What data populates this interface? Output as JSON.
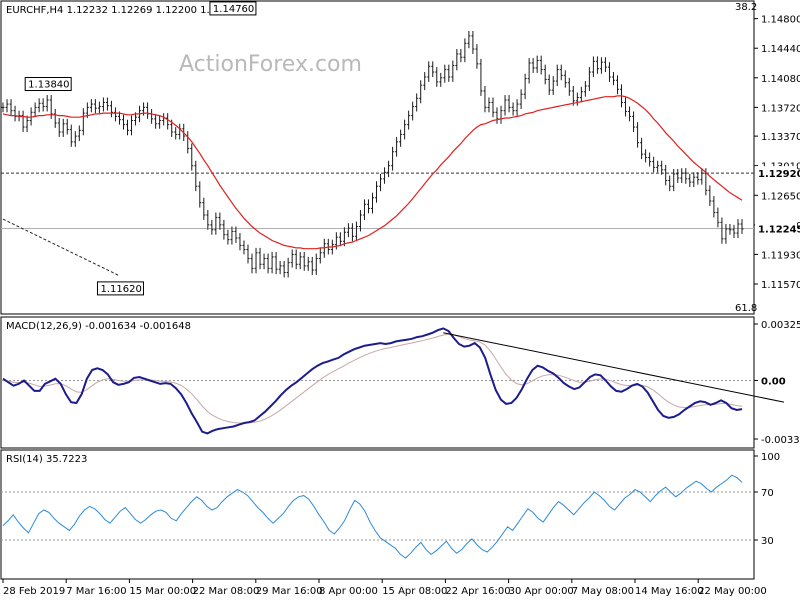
{
  "chart_data": [
    {
      "type": "line",
      "panel": "price",
      "title": "EURCHF,H4  1.12232 1.12269 1.12200 1.12245",
      "watermark": "ActionForex.com",
      "ylim": [
        1.1157,
        1.1482
      ],
      "y_ticks": [
        "1.14800",
        "1.14440",
        "1.14080",
        "1.13720",
        "1.13370",
        "1.13010",
        "1.12650",
        "1.12290",
        "1.11930",
        "1.11570"
      ],
      "x_labels": [
        "28 Feb 2019",
        "7 Mar 16:00",
        "15 Mar 00:00",
        "22 Mar 08:00",
        "29 Mar 16:00",
        "8 Apr 00:00",
        "15 Apr 08:00",
        "22 Apr 16:00",
        "30 Apr 00:00",
        "7 May 08:00",
        "14 May 16:00",
        "22 May 00:00"
      ],
      "fib_top_label": "38.2",
      "fib_bottom_label": "61.8",
      "annotations": [
        {
          "label": "1.13840",
          "x_index": 11,
          "y": 1.1384
        },
        {
          "label": "1.14760",
          "x_index": 57,
          "y": 1.1476
        },
        {
          "label": "1.11620",
          "x_index": 29,
          "y": 1.1162
        }
      ],
      "horizontal_level": {
        "label": "1.12920",
        "y": 1.1292
      },
      "current_price": {
        "label": "1.12245",
        "y": 1.12245
      },
      "trendline": {
        "from": {
          "x_index": 0,
          "y": 1.1236
        },
        "to": {
          "x_index": 29,
          "y": 1.1167
        }
      },
      "series": [
        {
          "kind": "price",
          "values": [
            1.1372,
            1.1376,
            1.1368,
            1.1361,
            1.1362,
            1.1348,
            1.1356,
            1.1366,
            1.1372,
            1.1377,
            1.1373,
            1.1381,
            1.1364,
            1.1353,
            1.1342,
            1.1352,
            1.1345,
            1.133,
            1.1337,
            1.1344,
            1.1365,
            1.1372,
            1.1376,
            1.1371,
            1.1373,
            1.1378,
            1.1374,
            1.1366,
            1.1361,
            1.1357,
            1.1351,
            1.1344,
            1.1356,
            1.136,
            1.1368,
            1.1372,
            1.1364,
            1.1358,
            1.1352,
            1.1356,
            1.1359,
            1.1351,
            1.1342,
            1.1339,
            1.1346,
            1.1337,
            1.1322,
            1.1301,
            1.1276,
            1.1256,
            1.1241,
            1.1229,
            1.1223,
            1.1238,
            1.1229,
            1.1217,
            1.1211,
            1.1221,
            1.1213,
            1.1204,
            1.1199,
            1.1188,
            1.1176,
            1.1195,
            1.1181,
            1.1188,
            1.1176,
            1.119,
            1.1175,
            1.1179,
            1.1171,
            1.1183,
            1.1193,
            1.1181,
            1.119,
            1.1179,
            1.1184,
            1.1174,
            1.1188,
            1.1195,
            1.1206,
            1.1199,
            1.1205,
            1.1214,
            1.1209,
            1.122,
            1.1225,
            1.1215,
            1.1227,
            1.1241,
            1.1254,
            1.1249,
            1.1262,
            1.1276,
            1.1285,
            1.1293,
            1.1301,
            1.1318,
            1.133,
            1.1339,
            1.1351,
            1.1362,
            1.1373,
            1.1383,
            1.1399,
            1.1409,
            1.1422,
            1.1415,
            1.1403,
            1.1408,
            1.1418,
            1.1409,
            1.1423,
            1.1437,
            1.1433,
            1.145,
            1.1459,
            1.1443,
            1.1425,
            1.1392,
            1.1372,
            1.1378,
            1.1366,
            1.1358,
            1.1368,
            1.1381,
            1.1372,
            1.1368,
            1.1376,
            1.1388,
            1.1407,
            1.1426,
            1.142,
            1.1429,
            1.1418,
            1.1406,
            1.1393,
            1.1404,
            1.1418,
            1.1411,
            1.1402,
            1.1392,
            1.138,
            1.1384,
            1.1391,
            1.1398,
            1.1415,
            1.1428,
            1.1419,
            1.1427,
            1.1421,
            1.1409,
            1.1405,
            1.1394,
            1.1378,
            1.1367,
            1.1361,
            1.1348,
            1.1329,
            1.1315,
            1.1311,
            1.1306,
            1.1299,
            1.1301,
            1.1296,
            1.1283,
            1.1276,
            1.1291,
            1.1286,
            1.1292,
            1.1285,
            1.1281,
            1.1287,
            1.1284,
            1.1292,
            1.1271,
            1.1258,
            1.1244,
            1.1232,
            1.1212,
            1.1224,
            1.1223,
            1.1219,
            1.123,
            1.1224
          ]
        },
        {
          "kind": "moving_average",
          "values": [
            1.1364,
            1.1363,
            1.1362,
            1.1362,
            1.1361,
            1.1361,
            1.136,
            1.136,
            1.1361,
            1.1362,
            1.1362,
            1.1363,
            1.1363,
            1.1363,
            1.1362,
            1.1362,
            1.1361,
            1.136,
            1.136,
            1.136,
            1.1361,
            1.1362,
            1.1363,
            1.1364,
            1.1364,
            1.1365,
            1.1365,
            1.1365,
            1.1365,
            1.1365,
            1.1364,
            1.1363,
            1.1363,
            1.1364,
            1.1364,
            1.1365,
            1.1365,
            1.1364,
            1.1363,
            1.1362,
            1.136,
            1.1357,
            1.1354,
            1.135,
            1.1346,
            1.1341,
            1.1336,
            1.133,
            1.1323,
            1.1316,
            1.1308,
            1.1301,
            1.1293,
            1.1285,
            1.1277,
            1.127,
            1.1263,
            1.1256,
            1.1249,
            1.1243,
            1.1237,
            1.1232,
            1.1227,
            1.1223,
            1.1219,
            1.1216,
            1.1213,
            1.121,
            1.1208,
            1.1206,
            1.1204,
            1.1203,
            1.1202,
            1.1201,
            1.1201,
            1.12,
            1.12,
            1.12,
            1.12,
            1.1201,
            1.1201,
            1.1202,
            1.1202,
            1.1203,
            1.1204,
            1.1206,
            1.1207,
            1.1208,
            1.121,
            1.1212,
            1.1214,
            1.1216,
            1.1219,
            1.1222,
            1.1225,
            1.1228,
            1.1232,
            1.1236,
            1.124,
            1.1245,
            1.125,
            1.1255,
            1.1261,
            1.1267,
            1.1273,
            1.1279,
            1.1285,
            1.1291,
            1.1296,
            1.1302,
            1.1307,
            1.1312,
            1.1318,
            1.1323,
            1.1328,
            1.1334,
            1.1339,
            1.1344,
            1.1348,
            1.1351,
            1.1352,
            1.1354,
            1.1356,
            1.1357,
            1.1358,
            1.1359,
            1.1359,
            1.136,
            1.1361,
            1.1362,
            1.1364,
            1.1365,
            1.1366,
            1.1368,
            1.1369,
            1.137,
            1.1371,
            1.1372,
            1.1373,
            1.1374,
            1.1375,
            1.1376,
            1.1377,
            1.1378,
            1.1379,
            1.138,
            1.1381,
            1.1382,
            1.1383,
            1.1384,
            1.1385,
            1.1385,
            1.1385,
            1.1386,
            1.1386,
            1.1385,
            1.1383,
            1.138,
            1.1377,
            1.1373,
            1.1369,
            1.1364,
            1.1358,
            1.1353,
            1.1347,
            1.1341,
            1.1336,
            1.1331,
            1.1325,
            1.132,
            1.1315,
            1.131,
            1.1305,
            1.1301,
            1.1297,
            1.1293,
            1.1288,
            1.1284,
            1.128,
            1.1276,
            1.1272,
            1.1268,
            1.1265,
            1.1262,
            1.1259
          ]
        }
      ]
    },
    {
      "type": "line",
      "panel": "macd",
      "title": "MACD(12,26,9) -0.001634 -0.001648",
      "ylim": [
        -0.003373,
        0.003253
      ],
      "y_ticks": [
        "0.003253",
        "0.00",
        "-0.003373"
      ],
      "zero_level": 0.0,
      "trendline": {
        "from": {
          "x_index": 84,
          "y": 0.00275
        },
        "to": {
          "x_index": 149,
          "y": -0.00125
        }
      },
      "series": [
        {
          "kind": "macd",
          "values": [
            0.0001,
            -0.0001,
            -0.0003,
            -0.0002,
            0.0,
            -0.0003,
            -0.0006,
            -0.0006,
            -0.0002,
            -5e-05,
            0.0001,
            -0.0002,
            -0.0008,
            -0.00125,
            -0.0013,
            -0.0008,
            0.0001,
            0.0006,
            0.0007,
            0.0006,
            0.00035,
            -0.0001,
            -0.00025,
            -0.0002,
            -0.0001,
            0.00015,
            0.0002,
            0.0001,
            0.0,
            -0.0001,
            -0.0002,
            -0.00015,
            -0.0002,
            -0.00045,
            -0.0008,
            -0.0013,
            -0.0019,
            -0.0024,
            -0.00295,
            -0.00305,
            -0.0029,
            -0.0028,
            -0.00275,
            -0.0027,
            -0.00265,
            -0.00255,
            -0.00245,
            -0.0024,
            -0.0023,
            -0.00205,
            -0.0018,
            -0.0015,
            -0.0012,
            -0.00085,
            -0.00055,
            -0.0003,
            -0.0001,
            0.00015,
            0.0004,
            0.00065,
            0.00085,
            0.001,
            0.0011,
            0.0012,
            0.0013,
            0.0015,
            0.00165,
            0.0018,
            0.0019,
            0.002,
            0.00205,
            0.0021,
            0.00215,
            0.0021,
            0.00215,
            0.00225,
            0.0023,
            0.00235,
            0.0024,
            0.0025,
            0.00255,
            0.00265,
            0.00275,
            0.0029,
            0.003,
            0.00285,
            0.00245,
            0.0021,
            0.00195,
            0.002,
            0.00215,
            0.0019,
            0.0013,
            0.00035,
            -0.00055,
            -0.0011,
            -0.00135,
            -0.0013,
            -0.001,
            -0.0005,
            0.0001,
            0.0006,
            0.00085,
            0.00075,
            0.00055,
            0.0004,
            0.00015,
            -0.00015,
            -0.00035,
            -0.0005,
            -0.0004,
            -0.0001,
            0.0002,
            0.00035,
            0.0003,
            0.0,
            -0.00035,
            -0.0006,
            -0.00065,
            -0.0005,
            -0.0003,
            -0.0002,
            -0.00035,
            -0.0007,
            -0.0012,
            -0.0017,
            -0.00205,
            -0.00215,
            -0.0021,
            -0.00195,
            -0.0017,
            -0.0015,
            -0.0013,
            -0.0012,
            -0.00125,
            -0.0014,
            -0.0013,
            -0.00115,
            -0.0013,
            -0.0016,
            -0.0017,
            -0.00165
          ]
        },
        {
          "kind": "signal",
          "values": [
            0.0,
            -5e-05,
            -0.0001,
            -0.00013,
            -0.0001,
            -0.00015,
            -0.00025,
            -0.00035,
            -0.00032,
            -0.00027,
            -0.00019,
            -0.00019,
            -0.00031,
            -0.0005,
            -0.00066,
            -0.00069,
            -0.00053,
            -0.0003,
            -0.0001,
            4e-05,
            0.0001,
            6e-05,
            0.0,
            -4e-05,
            -5e-05,
            -1e-05,
            3e-05,
            4e-05,
            3e-05,
            0.0,
            -4e-05,
            -6e-05,
            -9e-05,
            -0.00016,
            -0.00029,
            -0.00049,
            -0.00077,
            -0.0011,
            -0.00147,
            -0.00179,
            -0.00201,
            -0.00217,
            -0.00229,
            -0.00237,
            -0.00243,
            -0.00245,
            -0.00245,
            -0.00244,
            -0.00241,
            -0.00234,
            -0.00223,
            -0.00208,
            -0.0019,
            -0.00169,
            -0.00146,
            -0.00123,
            -0.001,
            -0.00077,
            -0.00053,
            -0.0003,
            -7e-05,
            0.00015,
            0.00034,
            0.00051,
            0.00067,
            0.00083,
            0.001,
            0.00116,
            0.00131,
            0.00145,
            0.00157,
            0.00168,
            0.00177,
            0.00184,
            0.0019,
            0.00197,
            0.00204,
            0.0021,
            0.00216,
            0.00223,
            0.00229,
            0.00237,
            0.00244,
            0.00253,
            0.00262,
            0.00267,
            0.00263,
            0.00252,
            0.00241,
            0.00233,
            0.00229,
            0.00221,
            0.00203,
            0.00169,
            0.00124,
            0.00077,
            0.00035,
            2e-05,
            -0.00018,
            -0.00025,
            -0.00018,
            -2e-05,
            0.00015,
            0.00027,
            0.00033,
            0.00034,
            0.0003,
            0.00021,
            0.0001,
            -2e-05,
            -0.0001,
            -0.0001,
            -4e-05,
            4e-05,
            9e-05,
            7e-05,
            -2e-05,
            -0.00014,
            -0.00024,
            -0.00029,
            -0.00029,
            -0.00027,
            -0.00029,
            -0.00037,
            -0.00054,
            -0.00077,
            -0.00103,
            -0.00125,
            -0.00142,
            -0.00153,
            -0.00156,
            -0.00155,
            -0.0015,
            -0.00144,
            -0.0014,
            -0.0014,
            -0.00138,
            -0.00133,
            -0.00133,
            -0.00138,
            -0.00145,
            -0.00149
          ]
        }
      ]
    },
    {
      "type": "line",
      "panel": "rsi",
      "title": "RSI(14) 35.7223",
      "ylim": [
        0,
        100
      ],
      "y_ticks": [
        "100",
        "70",
        "30"
      ],
      "levels": [
        70,
        30
      ],
      "series": [
        {
          "kind": "rsi",
          "values": [
            42,
            46,
            51,
            45,
            40,
            36,
            44,
            52,
            55,
            53,
            48,
            44,
            41,
            38,
            43,
            50,
            55,
            58,
            56,
            52,
            47,
            44,
            49,
            54,
            57,
            52,
            47,
            44,
            47,
            51,
            54,
            55,
            53,
            48,
            46,
            52,
            57,
            62,
            66,
            63,
            58,
            55,
            57,
            62,
            66,
            69,
            72,
            70,
            67,
            62,
            57,
            53,
            48,
            44,
            48,
            52,
            58,
            63,
            66,
            67,
            64,
            58,
            51,
            45,
            38,
            35,
            40,
            46,
            55,
            63,
            60,
            54,
            45,
            38,
            32,
            29,
            26,
            23,
            18,
            15,
            19,
            24,
            28,
            22,
            18,
            21,
            25,
            29,
            23,
            19,
            22,
            27,
            31,
            26,
            22,
            20,
            24,
            29,
            35,
            41,
            38,
            44,
            50,
            56,
            53,
            48,
            45,
            51,
            57,
            62,
            59,
            55,
            51,
            56,
            61,
            65,
            70,
            67,
            63,
            58,
            55,
            60,
            65,
            68,
            72,
            70,
            66,
            62,
            67,
            71,
            74,
            70,
            66,
            69,
            73,
            76,
            79,
            77,
            73,
            70,
            74,
            77,
            80,
            84,
            82,
            78
          ]
        }
      ]
    }
  ]
}
